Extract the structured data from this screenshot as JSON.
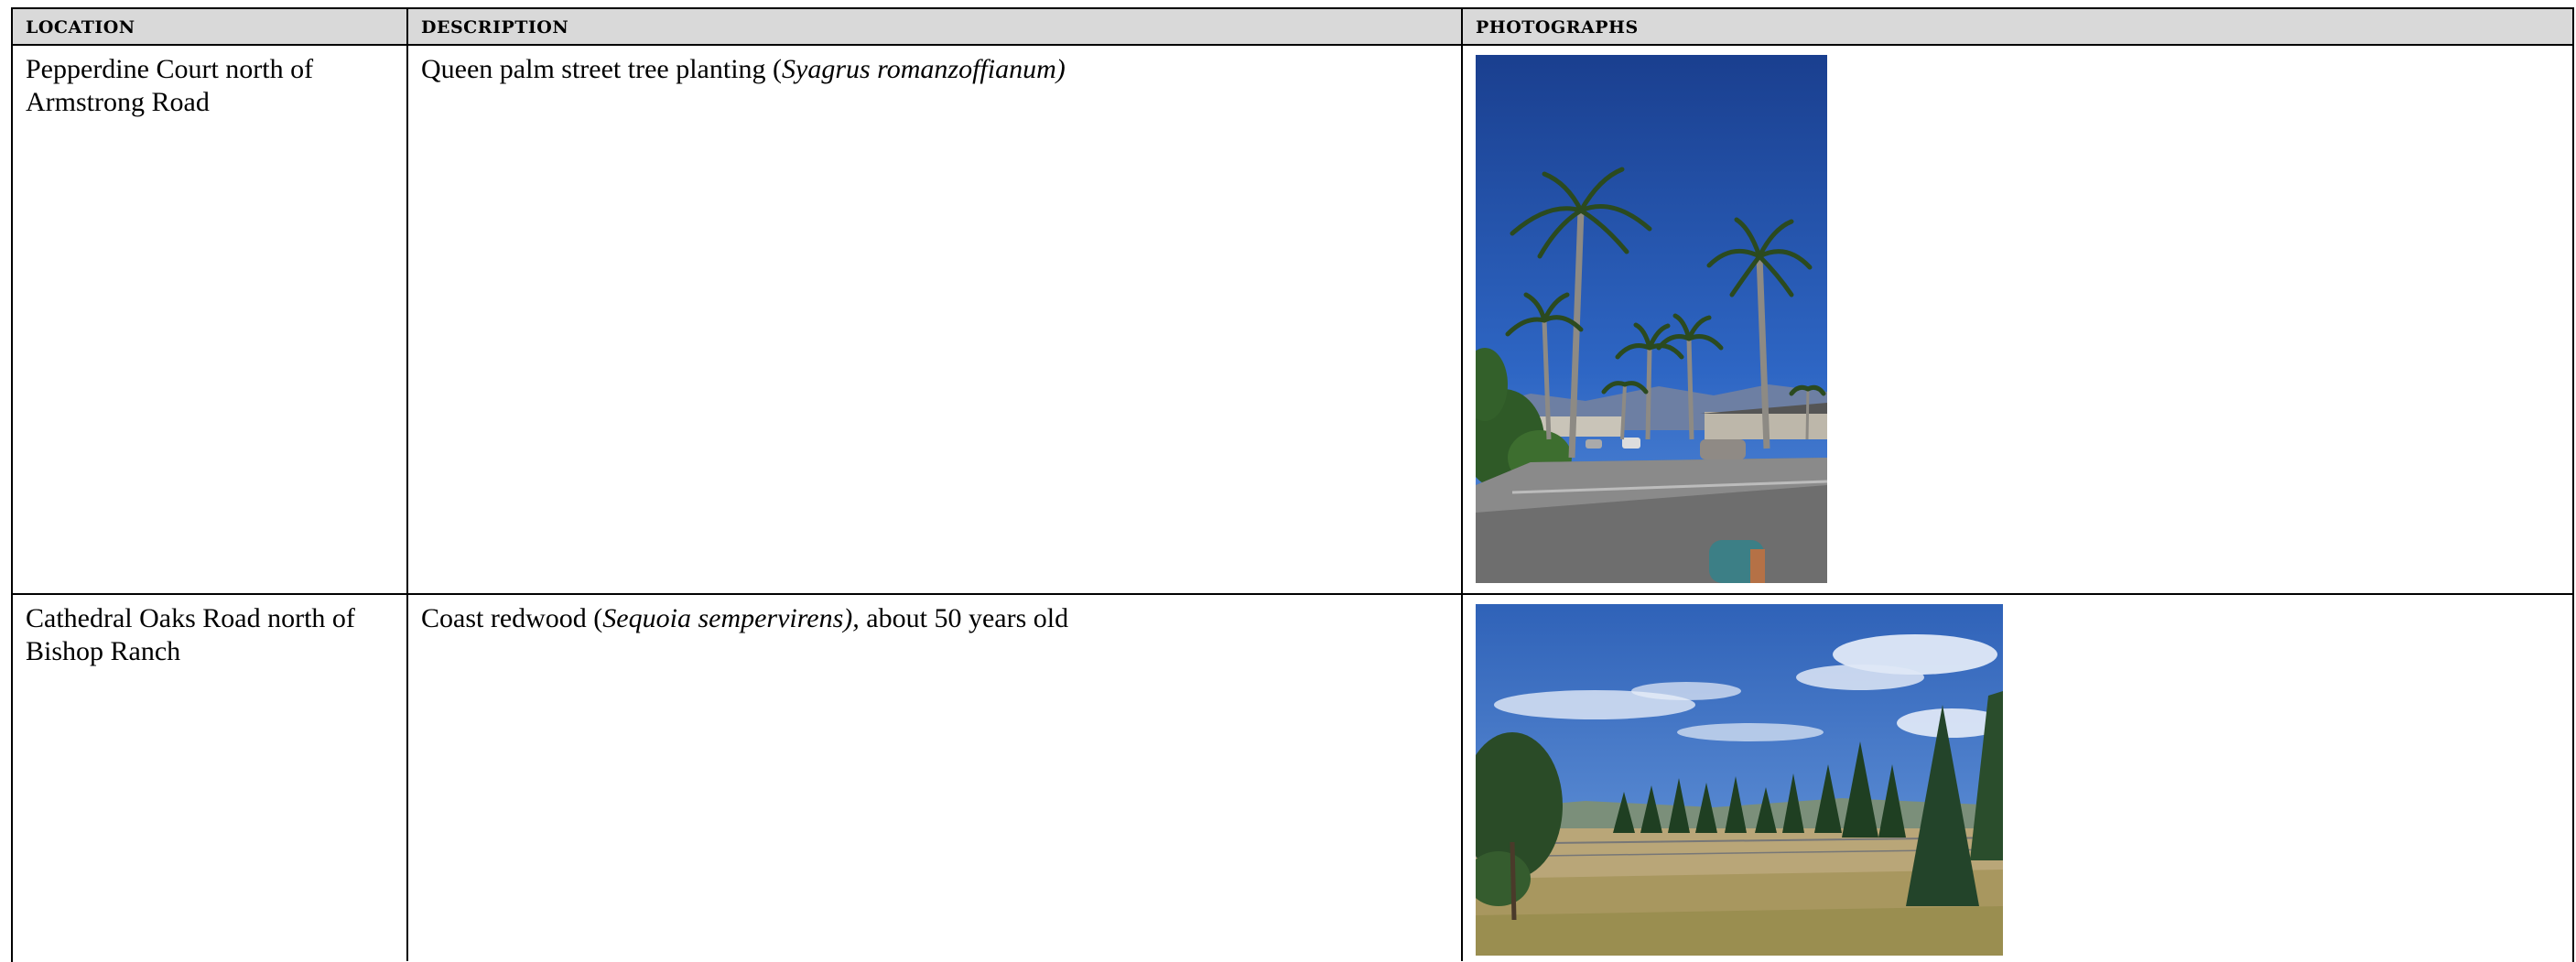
{
  "headers": {
    "location": "LOCATION",
    "description": "DESCRIPTION",
    "photographs": "PHOTOGRAPHS"
  },
  "rows": [
    {
      "location": "Pepperdine Court north of Armstrong Road",
      "description_prefix": "Queen palm street tree planting (",
      "description_species": "Syagrus romanzoffianum)",
      "description_suffix": "",
      "photo_icon": "palm-trees-street-photo"
    },
    {
      "location": "Cathedral Oaks Road north of Bishop Ranch",
      "description_prefix": "Coast redwood (",
      "description_species": "Sequoia sempervirens),",
      "description_suffix": " about 50 years old",
      "photo_icon": "redwood-trees-field-photo"
    }
  ]
}
